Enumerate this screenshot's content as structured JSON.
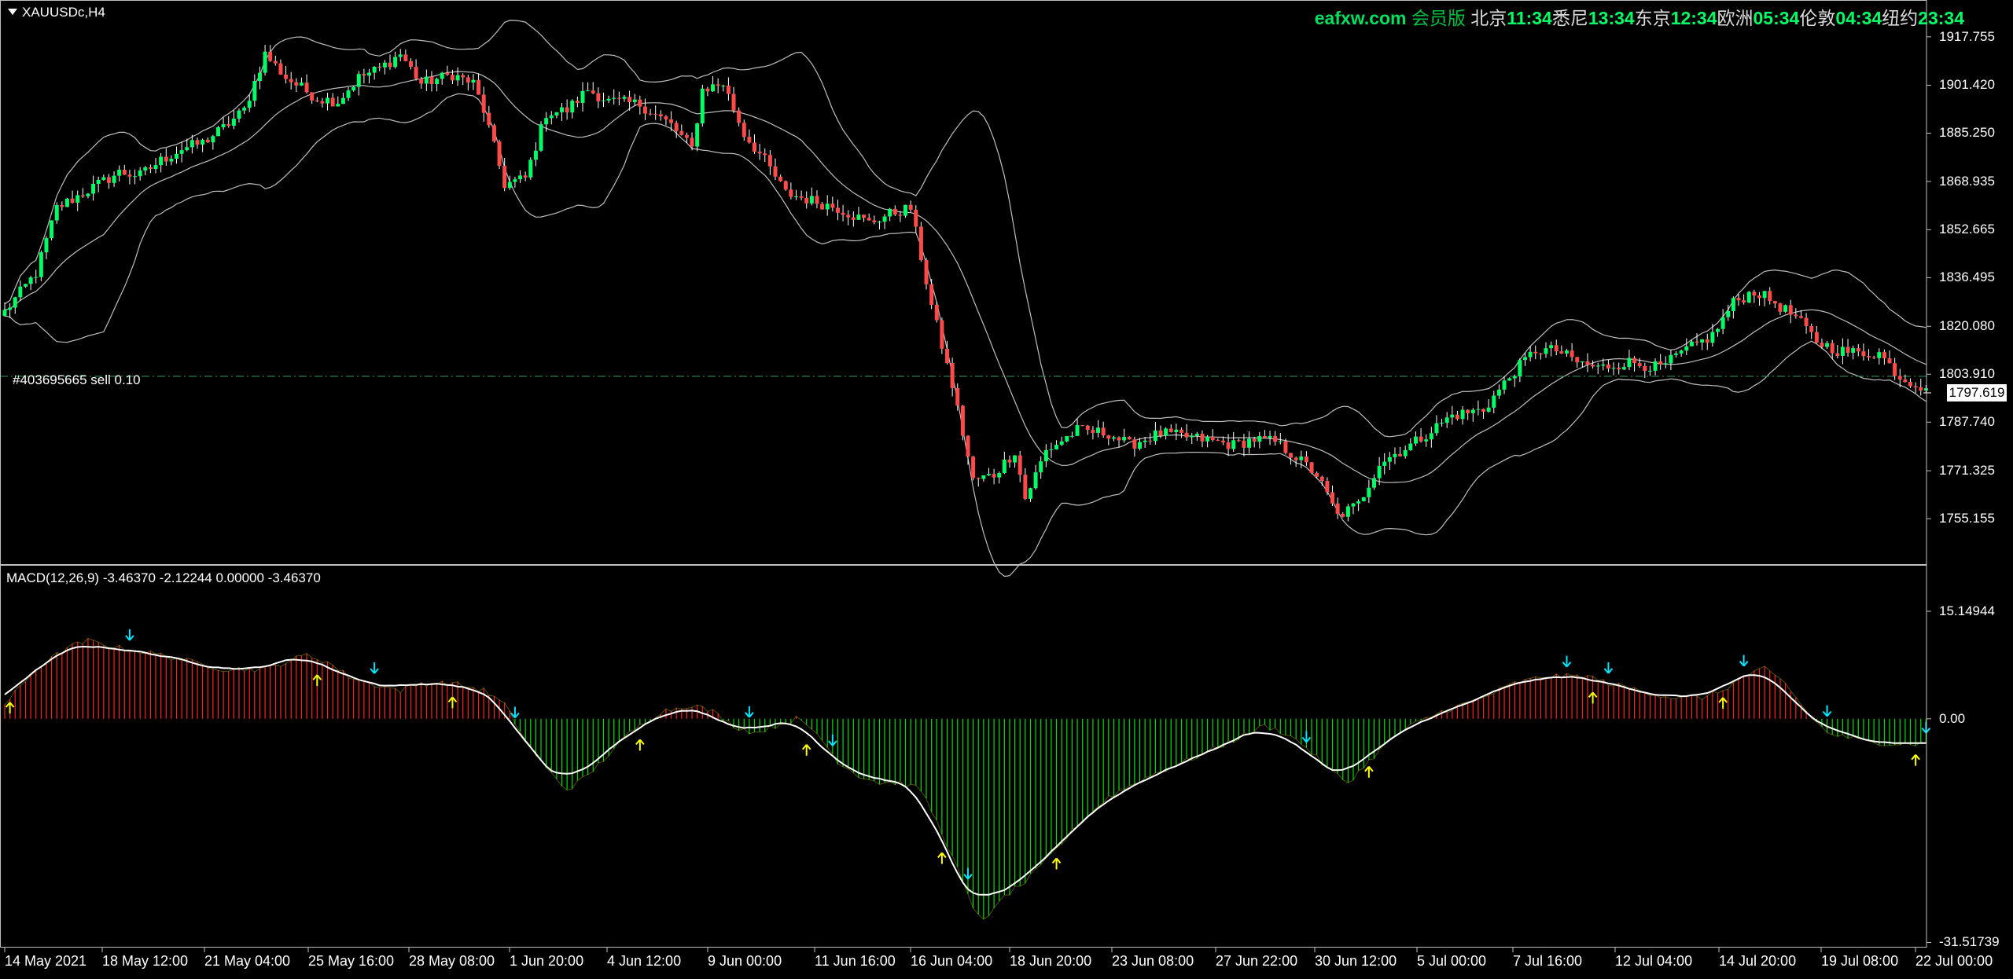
{
  "symbol": {
    "name": "XAUUSDc,H4",
    "menu_icon": "triangle-down-icon"
  },
  "clock": {
    "brand": "eafxw.com",
    "brand_suffix": "会员版",
    "cities": [
      {
        "name": "北京",
        "time": "11:34"
      },
      {
        "name": "悉尼",
        "time": "13:34"
      },
      {
        "name": "东京",
        "time": "12:34"
      },
      {
        "name": "欧洲",
        "time": "05:34"
      },
      {
        "name": "伦敦",
        "time": "04:34"
      },
      {
        "name": "纽约",
        "time": "23:34"
      }
    ]
  },
  "order_label": "#403695665 sell 0.10",
  "current_price": "1797.619",
  "macd_label": "MACD(12,26,9) -3.46370 -2.12244 0.00000 -3.46370",
  "colors": {
    "up": "#00ff66",
    "down": "#ff4a4a",
    "bb": "#bfbfbf",
    "macd_pos": "#ff2020",
    "macd_neg": "#00e000",
    "signal": "#ffffff",
    "arrow_up": "#ffff00",
    "arrow_down": "#00e5ff",
    "order_line": "#2e8b57"
  },
  "chart_data": [
    {
      "type": "candlestick",
      "title": "XAUUSDc,H4",
      "overlays": [
        "Bollinger Bands"
      ],
      "ylim": [
        1743,
        1927
      ],
      "y_ticks": [
        "1917.755",
        "1901.420",
        "1885.250",
        "1868.935",
        "1852.665",
        "1836.495",
        "1820.080",
        "1803.910",
        "1787.740",
        "1771.325",
        "1755.155"
      ],
      "x_ticks": [
        "14 May 2021",
        "18 May 12:00",
        "21 May 04:00",
        "25 May 16:00",
        "28 May 08:00",
        "1 Jun 20:00",
        "4 Jun 12:00",
        "9 Jun 00:00",
        "11 Jun 16:00",
        "16 Jun 04:00",
        "18 Jun 20:00",
        "23 Jun 08:00",
        "27 Jun 22:00",
        "30 Jun 12:00",
        "5 Jul 00:00",
        "7 Jul 16:00",
        "12 Jul 04:00",
        "14 Jul 20:00",
        "19 Jul 08:00",
        "22 Jul 00:00"
      ],
      "anchors": [
        [
          0,
          1825
        ],
        [
          6,
          1838
        ],
        [
          10,
          1860
        ],
        [
          16,
          1866
        ],
        [
          22,
          1872
        ],
        [
          26,
          1871
        ],
        [
          30,
          1876
        ],
        [
          34,
          1880
        ],
        [
          38,
          1882
        ],
        [
          42,
          1887
        ],
        [
          46,
          1893
        ],
        [
          50,
          1912
        ],
        [
          54,
          1904
        ],
        [
          60,
          1897
        ],
        [
          64,
          1896
        ],
        [
          68,
          1904
        ],
        [
          72,
          1907
        ],
        [
          76,
          1912
        ],
        [
          80,
          1902
        ],
        [
          86,
          1905
        ],
        [
          90,
          1902
        ],
        [
          92,
          1893
        ],
        [
          96,
          1868
        ],
        [
          100,
          1870
        ],
        [
          104,
          1892
        ],
        [
          108,
          1893
        ],
        [
          112,
          1900
        ],
        [
          116,
          1896
        ],
        [
          122,
          1895
        ],
        [
          128,
          1888
        ],
        [
          132,
          1880
        ],
        [
          134,
          1900
        ],
        [
          138,
          1902
        ],
        [
          142,
          1885
        ],
        [
          146,
          1876
        ],
        [
          150,
          1865
        ],
        [
          156,
          1862
        ],
        [
          160,
          1860
        ],
        [
          166,
          1855
        ],
        [
          170,
          1858
        ],
        [
          174,
          1860
        ],
        [
          178,
          1827
        ],
        [
          182,
          1800
        ],
        [
          186,
          1768
        ],
        [
          190,
          1770
        ],
        [
          194,
          1778
        ],
        [
          196,
          1762
        ],
        [
          200,
          1778
        ],
        [
          206,
          1785
        ],
        [
          212,
          1784
        ],
        [
          216,
          1780
        ],
        [
          222,
          1784
        ],
        [
          230,
          1782
        ],
        [
          236,
          1780
        ],
        [
          240,
          1782
        ],
        [
          244,
          1781
        ],
        [
          248,
          1776
        ],
        [
          252,
          1770
        ],
        [
          256,
          1756
        ],
        [
          260,
          1760
        ],
        [
          264,
          1774
        ],
        [
          270,
          1780
        ],
        [
          278,
          1790
        ],
        [
          284,
          1792
        ],
        [
          290,
          1805
        ],
        [
          294,
          1812
        ],
        [
          298,
          1812
        ],
        [
          302,
          1808
        ],
        [
          306,
          1806
        ],
        [
          312,
          1808
        ],
        [
          318,
          1806
        ],
        [
          322,
          1811
        ],
        [
          328,
          1817
        ],
        [
          332,
          1828
        ],
        [
          336,
          1832
        ],
        [
          340,
          1828
        ],
        [
          344,
          1823
        ],
        [
          348,
          1815
        ],
        [
          352,
          1812
        ],
        [
          356,
          1811
        ],
        [
          360,
          1811
        ],
        [
          364,
          1803
        ],
        [
          368,
          1800
        ]
      ],
      "current_price": 1797.619,
      "order_line": {
        "label": "#403695665 sell 0.10",
        "price": 1803.2
      }
    },
    {
      "type": "macd",
      "title": "MACD(12,26,9) -3.46370 -2.12244 0.00000 -3.46370",
      "params": [
        12,
        26,
        9
      ],
      "values": {
        "main": -3.4637,
        "signal": -2.12244,
        "zero": 0.0,
        "hist": -3.4637
      },
      "ylim": [
        -31.5739,
        15.14944
      ],
      "y_ticks": [
        "15.14944",
        "0.00",
        "-31.51739"
      ],
      "hist_anchors": [
        [
          0,
          2
        ],
        [
          6,
          7
        ],
        [
          12,
          10
        ],
        [
          16,
          11
        ],
        [
          22,
          10
        ],
        [
          30,
          9
        ],
        [
          36,
          8
        ],
        [
          42,
          7
        ],
        [
          46,
          7
        ],
        [
          50,
          7
        ],
        [
          54,
          8
        ],
        [
          58,
          9
        ],
        [
          62,
          8
        ],
        [
          66,
          6
        ],
        [
          70,
          5
        ],
        [
          76,
          4
        ],
        [
          80,
          5
        ],
        [
          86,
          5
        ],
        [
          92,
          4
        ],
        [
          96,
          2
        ],
        [
          100,
          -3
        ],
        [
          104,
          -7
        ],
        [
          108,
          -10
        ],
        [
          112,
          -8
        ],
        [
          116,
          -5
        ],
        [
          120,
          -2
        ],
        [
          126,
          1
        ],
        [
          132,
          2
        ],
        [
          136,
          1
        ],
        [
          140,
          -1
        ],
        [
          144,
          -2
        ],
        [
          148,
          -1
        ],
        [
          152,
          0
        ],
        [
          156,
          -2
        ],
        [
          160,
          -6
        ],
        [
          164,
          -8
        ],
        [
          168,
          -9
        ],
        [
          172,
          -9
        ],
        [
          176,
          -10
        ],
        [
          180,
          -16
        ],
        [
          184,
          -23
        ],
        [
          186,
          -27
        ],
        [
          188,
          -28
        ],
        [
          190,
          -27
        ],
        [
          192,
          -25
        ],
        [
          196,
          -23
        ],
        [
          200,
          -20
        ],
        [
          206,
          -15
        ],
        [
          212,
          -11
        ],
        [
          220,
          -8
        ],
        [
          230,
          -5
        ],
        [
          236,
          -3
        ],
        [
          242,
          -1
        ],
        [
          246,
          -2
        ],
        [
          250,
          -4
        ],
        [
          254,
          -7
        ],
        [
          258,
          -9
        ],
        [
          262,
          -6
        ],
        [
          266,
          -3
        ],
        [
          270,
          -1
        ],
        [
          276,
          1
        ],
        [
          284,
          3
        ],
        [
          290,
          5
        ],
        [
          296,
          6
        ],
        [
          300,
          6
        ],
        [
          304,
          6
        ],
        [
          308,
          5
        ],
        [
          314,
          4
        ],
        [
          320,
          3
        ],
        [
          326,
          3
        ],
        [
          330,
          4
        ],
        [
          334,
          6
        ],
        [
          338,
          7
        ],
        [
          342,
          5
        ],
        [
          346,
          1
        ],
        [
          350,
          -2
        ],
        [
          356,
          -3
        ],
        [
          362,
          -3.5
        ],
        [
          368,
          -3.5
        ]
      ],
      "signal_arrows_up": [
        1,
        60,
        86,
        122,
        154,
        180,
        202,
        262,
        305,
        330,
        367
      ],
      "signal_arrows_down": [
        24,
        71,
        98,
        143,
        159,
        185,
        250,
        300,
        308,
        334,
        350,
        369
      ]
    }
  ]
}
